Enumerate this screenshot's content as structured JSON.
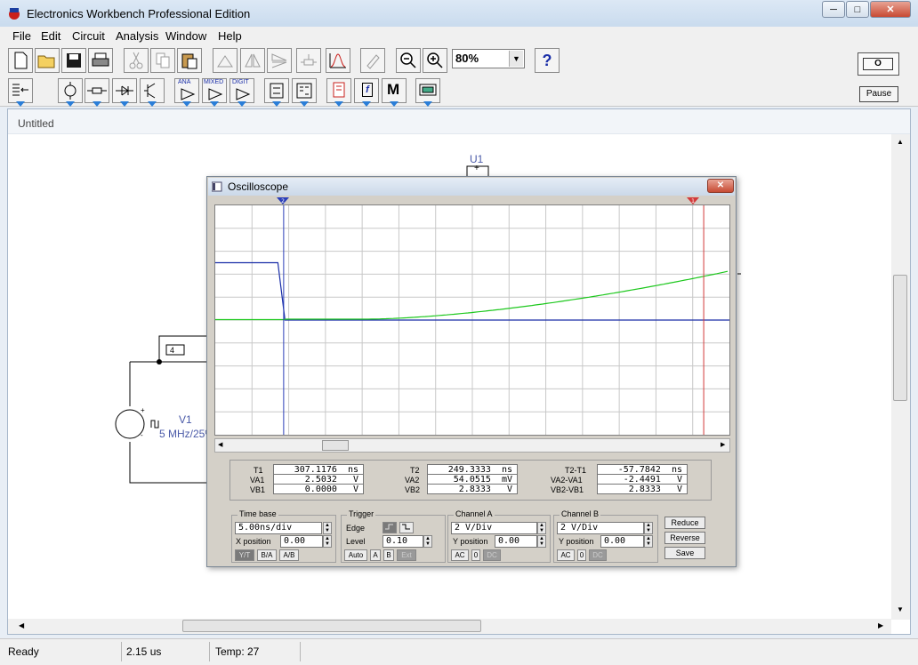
{
  "window": {
    "title": "Electronics Workbench Professional Edition",
    "min": "─",
    "max": "□",
    "close": "✕"
  },
  "menu": [
    "File",
    "Edit",
    "Circuit",
    "Analysis",
    "Window",
    "Help"
  ],
  "toolbar": {
    "zoom": "80%",
    "help": "?",
    "pause": "Pause",
    "power": "O"
  },
  "parts_toolbar": {
    "ana": "ANA",
    "mixed": "MIXED",
    "digit": "DIGIT",
    "m": "M",
    "f": "f"
  },
  "document": {
    "title": "Untitled"
  },
  "circuit": {
    "u1_label": "U1",
    "node_label": "4",
    "v1_label": "V1",
    "v1_value": "5 MHz/25%",
    "plus": "+",
    "minus": "-"
  },
  "oscilloscope": {
    "title": "Oscilloscope",
    "cursor1": "1",
    "cursor2": "2",
    "readouts": {
      "t1": {
        "label": "T1",
        "value": "307.1176  ns"
      },
      "va1": {
        "label": "VA1",
        "value": "2.5032   V"
      },
      "vb1": {
        "label": "VB1",
        "value": "0.0000   V"
      },
      "t2": {
        "label": "T2",
        "value": "249.3333  ns"
      },
      "va2": {
        "label": "VA2",
        "value": "54.0515  mV"
      },
      "vb2": {
        "label": "VB2",
        "value": "2.8333   V"
      },
      "dt": {
        "label": "T2-T1",
        "value": "-57.7842  ns"
      },
      "dva": {
        "label": "VA2-VA1",
        "value": "-2.4491   V"
      },
      "dvb": {
        "label": "VB2-VB1",
        "value": "2.8333   V"
      }
    },
    "timebase": {
      "title": "Time base",
      "value": "5.00ns/div",
      "xpos_label": "X position",
      "xpos": "0.00",
      "modes": [
        "Y/T",
        "B/A",
        "A/B"
      ]
    },
    "trigger": {
      "title": "Trigger",
      "edge_label": "Edge",
      "level_label": "Level",
      "level": "0.10",
      "sources": [
        "Auto",
        "A",
        "B",
        "Ext"
      ]
    },
    "channel_a": {
      "title": "Channel A",
      "value": "2 V/Div",
      "ypos_label": "Y position",
      "ypos": "0.00",
      "coupling": [
        "AC",
        "0",
        "DC"
      ]
    },
    "channel_b": {
      "title": "Channel B",
      "value": "2 V/Div",
      "ypos_label": "Y position",
      "ypos": "0.00",
      "coupling": [
        "AC",
        "0",
        "DC"
      ]
    },
    "buttons": {
      "reduce": "Reduce",
      "reverse": "Reverse",
      "save": "Save"
    },
    "trace_colors": {
      "channel_a": "#1ec81e",
      "channel_b": "#1a2ea8",
      "cursor1": "#d23a3a",
      "cursor2": "#2a3eb8"
    }
  },
  "status": {
    "ready": "Ready",
    "time": "2.15 us",
    "temp": "Temp:  27"
  }
}
